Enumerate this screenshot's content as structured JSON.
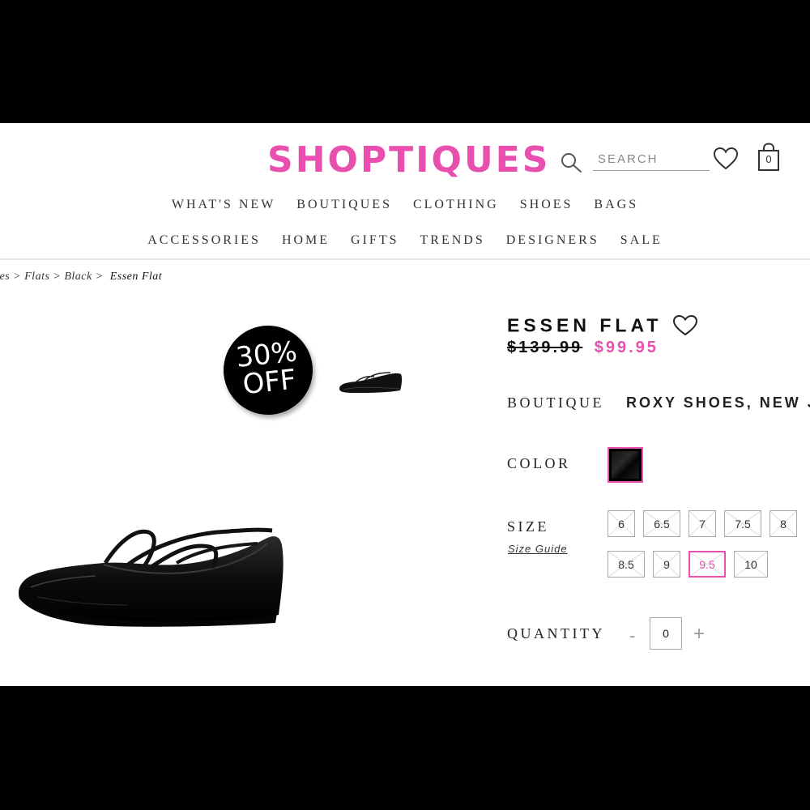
{
  "header": {
    "logo": "SHOPTIQUES",
    "search_placeholder": "SEARCH",
    "cart_count": "0"
  },
  "nav": {
    "row1": [
      "WHAT'S NEW",
      "BOUTIQUES",
      "CLOTHING",
      "SHOES",
      "BAGS"
    ],
    "row2": [
      "ACCESSORIES",
      "HOME",
      "GIFTS",
      "TRENDS",
      "DESIGNERS",
      "SALE"
    ]
  },
  "breadcrumb": {
    "items": [
      "oes",
      "Flats",
      "Black"
    ],
    "separator": " > ",
    "current": "Essen Flat"
  },
  "badge": {
    "line1": "30%",
    "line2": "OFF"
  },
  "product": {
    "title": "ESSEN FLAT",
    "old_price": "$139.99",
    "new_price": "$99.95",
    "boutique_label": "BOUTIQUE",
    "boutique_value": "ROXY SHOES, NEW J",
    "color_label": "COLOR",
    "color_value": "#000000",
    "size_label": "SIZE",
    "size_guide": "Size Guide",
    "sizes_row1": [
      "6",
      "6.5",
      "7",
      "7.5",
      "8"
    ],
    "sizes_row2": [
      "8.5",
      "9",
      "9.5",
      "10"
    ],
    "selected_size": "9.5",
    "quantity_label": "QUANTITY",
    "quantity_minus": "-",
    "quantity_plus": "+",
    "quantity_value": "0"
  },
  "colors": {
    "accent": "#e84fae",
    "text": "#111111",
    "frame": "#000000"
  }
}
